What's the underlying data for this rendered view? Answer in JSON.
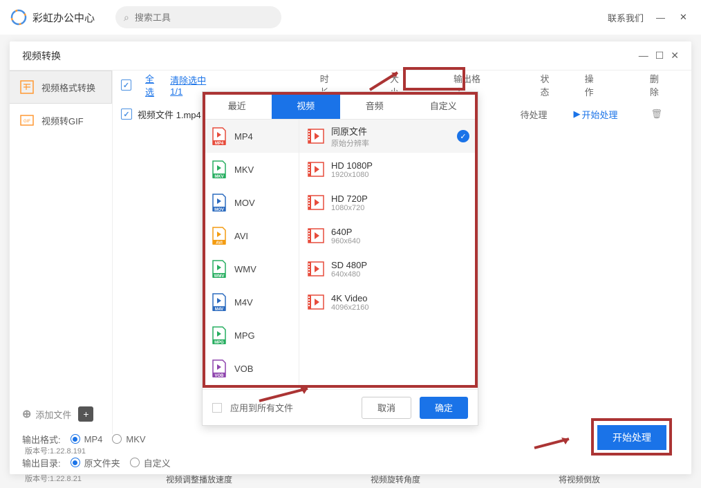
{
  "app": {
    "title": "彩虹办公中心",
    "search_placeholder": "搜索工具",
    "contact": "联系我们"
  },
  "modal": {
    "title": "视频转换"
  },
  "sidebar": {
    "items": [
      {
        "label": "视频格式转换",
        "icon": "convert",
        "color": "#ff9933"
      },
      {
        "label": "视频转GIF",
        "icon": "gif",
        "color": "#ff9933"
      }
    ]
  },
  "list_header": {
    "select_all": "全选",
    "clear_selected": "清除选中1/1",
    "cols": [
      "时长",
      "大小",
      "输出格式",
      "状态",
      "操作",
      "删除"
    ]
  },
  "file_row": {
    "name": "视频文件 1.mp4",
    "status": "待处理",
    "start": "开始处理"
  },
  "format_dropdown": {
    "tabs": [
      "最近",
      "视频",
      "音频",
      "自定义"
    ],
    "formats": [
      {
        "label": "MP4",
        "color": "#e74c3c",
        "tag": "MP4"
      },
      {
        "label": "MKV",
        "color": "#27ae60",
        "tag": "MKV"
      },
      {
        "label": "MOV",
        "color": "#2c6bbf",
        "tag": "MOV"
      },
      {
        "label": "AVI",
        "color": "#f39c12",
        "tag": "AVI"
      },
      {
        "label": "WMV",
        "color": "#27ae60",
        "tag": "WMV"
      },
      {
        "label": "M4V",
        "color": "#2c6bbf",
        "tag": "M4V"
      },
      {
        "label": "MPG",
        "color": "#27ae60",
        "tag": "MPG"
      },
      {
        "label": "VOB",
        "color": "#8e44ad",
        "tag": "VOB"
      }
    ],
    "resolutions": [
      {
        "title": "同原文件",
        "sub": "原始分辨率",
        "selected": true
      },
      {
        "title": "HD 1080P",
        "sub": "1920x1080"
      },
      {
        "title": "HD 720P",
        "sub": "1080x720"
      },
      {
        "title": "640P",
        "sub": "960x640"
      },
      {
        "title": "SD 480P",
        "sub": "640x480"
      },
      {
        "title": "4K Video",
        "sub": "4096x2160"
      }
    ],
    "apply_all": "应用到所有文件",
    "cancel": "取消",
    "ok": "确定"
  },
  "bottom": {
    "add_file": "添加文件",
    "output_format_label": "输出格式:",
    "mp4": "MP4",
    "mkv": "MKV",
    "output_dir_label": "输出目录:",
    "original_dir": "原文件夹",
    "custom_dir": "自定义"
  },
  "main_action": "开始处理",
  "version1": "版本号:1.22.8.191",
  "version2": "版本号:1.22.8.21",
  "features": [
    "视频调整播放速度",
    "视频旋转角度",
    "将视频倒放"
  ]
}
